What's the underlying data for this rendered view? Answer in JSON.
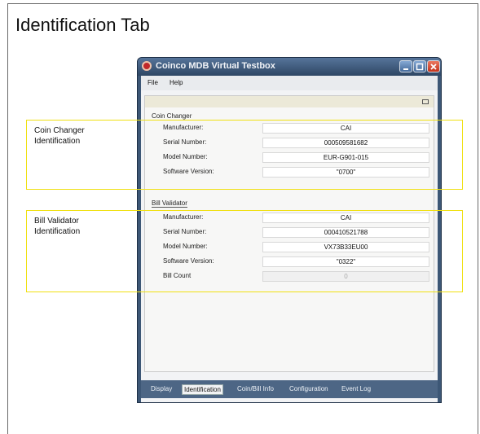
{
  "slide": {
    "title": "Identification Tab"
  },
  "window": {
    "title": "Coinco MDB Virtual Testbox"
  },
  "menu": [
    "File",
    "Help"
  ],
  "coin_changer": {
    "title": "Coin Changer",
    "rows": [
      {
        "label": "Manufacturer:",
        "value": "CAI"
      },
      {
        "label": "Serial Number:",
        "value": "000509581682"
      },
      {
        "label": "Model Number:",
        "value": "EUR-G901-015"
      },
      {
        "label": "Software Version:",
        "value": "\"0700\""
      }
    ]
  },
  "bill_validator": {
    "title": "Bill Validator",
    "rows": [
      {
        "label": "Manufacturer:",
        "value": "CAI"
      },
      {
        "label": "Serial Number:",
        "value": "000410521788"
      },
      {
        "label": "Model Number:",
        "value": "VX73B33EU00"
      },
      {
        "label": "Software Version:",
        "value": "\"0322\""
      },
      {
        "label": "Bill Count",
        "value": "0"
      }
    ]
  },
  "tabs": [
    "Display",
    "Identification",
    "Coin/Bill Info",
    "Configuration",
    "Event Log"
  ],
  "active_tab": "Identification",
  "callouts": {
    "coin": [
      "Coin Changer",
      "Identification"
    ],
    "bill": [
      "Bill Validator",
      "Identification"
    ]
  },
  "colors": {
    "highlight": "#f0e012",
    "titlebar": "#2e4764",
    "close_button": "#c3311a"
  }
}
